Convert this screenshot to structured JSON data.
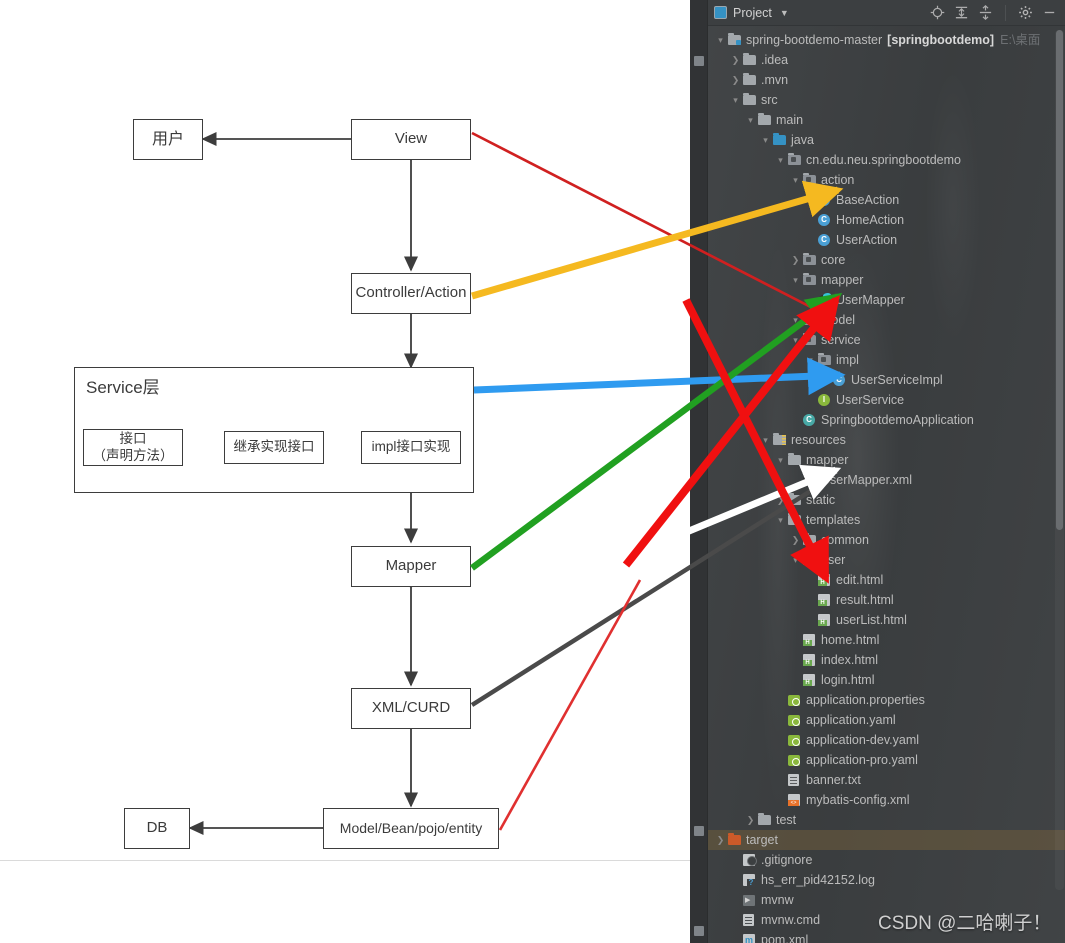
{
  "diagram": {
    "boxes": [
      {
        "id": "user",
        "label": "用户"
      },
      {
        "id": "view",
        "label": "View"
      },
      {
        "id": "controller",
        "label": "Controller/Action"
      },
      {
        "id": "mapper",
        "label": "Mapper"
      },
      {
        "id": "xmlcurd",
        "label": "XML/CURD"
      },
      {
        "id": "db",
        "label": "DB"
      },
      {
        "id": "model",
        "label": "Model/Bean/pojo/entity"
      }
    ],
    "service_group": {
      "title": "Service层",
      "items": [
        {
          "id": "interface",
          "label": "接口\n（声明方法）"
        },
        {
          "id": "inherit-impl",
          "label": "继承实现接口"
        },
        {
          "id": "impl-interface",
          "label": "impl接口实现"
        }
      ]
    },
    "annotation_arrows": [
      {
        "name": "view-to-action",
        "color": "#e03030",
        "from": "View",
        "to": "model folder"
      },
      {
        "name": "controller-to-action",
        "color": "#f5b920",
        "from": "Controller/Action",
        "to": "action package"
      },
      {
        "name": "service-to-impl",
        "color": "#2f9bf0",
        "from": "Service层",
        "to": "impl package"
      },
      {
        "name": "mapper-to-usermapper",
        "color": "#21a021",
        "from": "Mapper",
        "to": "UserMapper"
      },
      {
        "name": "xmlcurd-to-mapperxml",
        "color": "#ffffff",
        "from": "XML/CURD",
        "to": "mapper (resources)"
      },
      {
        "name": "model-to-templates",
        "color": "#f01010",
        "from": "Model/Bean/pojo/entity",
        "to": "templates/user"
      }
    ],
    "connector_color": "#3d3d3d"
  },
  "ide": {
    "stripe": {
      "top_tab": "Project",
      "bottom_tabs": [
        "Bookmarks",
        "Structure"
      ]
    },
    "toolbar": {
      "title": "Project",
      "dropdown_icon": "chevron-down-icon",
      "icons": [
        {
          "name": "locate-icon",
          "glyph": "locate"
        },
        {
          "name": "expand-all-icon",
          "glyph": "expand"
        },
        {
          "name": "collapse-all-icon",
          "glyph": "collapse"
        },
        {
          "name": "settings-gear-icon",
          "glyph": "gear"
        },
        {
          "name": "minimize-icon",
          "glyph": "minimize"
        }
      ]
    },
    "tree": [
      {
        "indent": 0,
        "arrow": "expanded",
        "icon": "folder-module",
        "name": "spring-bootdemo-master",
        "bold_suffix": "[springbootdemo]",
        "path": "E:\\桌面",
        "selected": false
      },
      {
        "indent": 1,
        "arrow": "collapsed",
        "icon": "folder",
        "name": ".idea"
      },
      {
        "indent": 1,
        "arrow": "collapsed",
        "icon": "folder",
        "name": ".mvn"
      },
      {
        "indent": 1,
        "arrow": "expanded",
        "icon": "folder",
        "name": "src"
      },
      {
        "indent": 2,
        "arrow": "expanded",
        "icon": "folder",
        "name": "main"
      },
      {
        "indent": 3,
        "arrow": "expanded",
        "icon": "folder-source",
        "name": "java"
      },
      {
        "indent": 4,
        "arrow": "expanded",
        "icon": "package",
        "name": "cn.edu.neu.springbootdemo"
      },
      {
        "indent": 5,
        "arrow": "expanded",
        "icon": "package",
        "name": "action"
      },
      {
        "indent": 6,
        "arrow": "none",
        "icon": "class",
        "name": "BaseAction"
      },
      {
        "indent": 6,
        "arrow": "none",
        "icon": "class",
        "name": "HomeAction"
      },
      {
        "indent": 6,
        "arrow": "none",
        "icon": "class",
        "name": "UserAction"
      },
      {
        "indent": 5,
        "arrow": "collapsed",
        "icon": "package",
        "name": "core"
      },
      {
        "indent": 5,
        "arrow": "expanded",
        "icon": "package",
        "name": "mapper"
      },
      {
        "indent": 6,
        "arrow": "none",
        "icon": "mapper-file",
        "name": "UserMapper"
      },
      {
        "indent": 5,
        "arrow": "expanded",
        "icon": "package",
        "name": "model"
      },
      {
        "indent": 5,
        "arrow": "expanded",
        "icon": "package",
        "name": "service"
      },
      {
        "indent": 6,
        "arrow": "expanded",
        "icon": "package",
        "name": "impl"
      },
      {
        "indent": 7,
        "arrow": "none",
        "icon": "class",
        "name": "UserServiceImpl"
      },
      {
        "indent": 6,
        "arrow": "none",
        "icon": "interface",
        "name": "UserService"
      },
      {
        "indent": 5,
        "arrow": "none",
        "icon": "spring-class",
        "name": "SpringbootdemoApplication"
      },
      {
        "indent": 3,
        "arrow": "expanded",
        "icon": "folder-res",
        "name": "resources"
      },
      {
        "indent": 4,
        "arrow": "expanded",
        "icon": "folder",
        "name": "mapper"
      },
      {
        "indent": 5,
        "arrow": "none",
        "icon": "mapper-file",
        "name": "UserMapper.xml"
      },
      {
        "indent": 4,
        "arrow": "collapsed",
        "icon": "folder",
        "name": "static"
      },
      {
        "indent": 4,
        "arrow": "expanded",
        "icon": "folder",
        "name": "templates"
      },
      {
        "indent": 5,
        "arrow": "collapsed",
        "icon": "folder",
        "name": "common"
      },
      {
        "indent": 5,
        "arrow": "expanded",
        "icon": "folder",
        "name": "user"
      },
      {
        "indent": 6,
        "arrow": "none",
        "icon": "html",
        "name": "edit.html"
      },
      {
        "indent": 6,
        "arrow": "none",
        "icon": "html",
        "name": "result.html"
      },
      {
        "indent": 6,
        "arrow": "none",
        "icon": "html",
        "name": "userList.html"
      },
      {
        "indent": 5,
        "arrow": "none",
        "icon": "html",
        "name": "home.html"
      },
      {
        "indent": 5,
        "arrow": "none",
        "icon": "html",
        "name": "index.html"
      },
      {
        "indent": 5,
        "arrow": "none",
        "icon": "html",
        "name": "login.html"
      },
      {
        "indent": 4,
        "arrow": "none",
        "icon": "yaml",
        "name": "application.properties"
      },
      {
        "indent": 4,
        "arrow": "none",
        "icon": "yaml",
        "name": "application.yaml"
      },
      {
        "indent": 4,
        "arrow": "none",
        "icon": "yaml",
        "name": "application-dev.yaml"
      },
      {
        "indent": 4,
        "arrow": "none",
        "icon": "yaml",
        "name": "application-pro.yaml"
      },
      {
        "indent": 4,
        "arrow": "none",
        "icon": "txt",
        "name": "banner.txt"
      },
      {
        "indent": 4,
        "arrow": "none",
        "icon": "xml",
        "name": "mybatis-config.xml"
      },
      {
        "indent": 2,
        "arrow": "collapsed",
        "icon": "folder",
        "name": "test"
      },
      {
        "indent": 0,
        "arrow": "collapsed",
        "icon": "folder-target",
        "name": "target",
        "selected": true
      },
      {
        "indent": 1,
        "arrow": "none",
        "icon": "gitignore",
        "name": ".gitignore"
      },
      {
        "indent": 1,
        "arrow": "none",
        "icon": "log",
        "name": "hs_err_pid42152.log"
      },
      {
        "indent": 1,
        "arrow": "none",
        "icon": "sh",
        "name": "mvnw"
      },
      {
        "indent": 1,
        "arrow": "none",
        "icon": "cmd",
        "name": "mvnw.cmd"
      },
      {
        "indent": 1,
        "arrow": "none",
        "icon": "pom",
        "name": "pom.xml"
      }
    ]
  },
  "watermark": {
    "text": "CSDN @二哈喇子！"
  },
  "colors": {
    "ide_bg": "#3c3f41",
    "ide_stripe": "#313335",
    "selection": "#6f5a3c",
    "text": "#bcbcbc",
    "red": "#e03030",
    "orange": "#f5b920",
    "blue": "#2f9bf0",
    "green": "#21a021",
    "white": "#ffffff",
    "bright_red": "#f01010",
    "gray_arrow": "#4a4a4a"
  }
}
